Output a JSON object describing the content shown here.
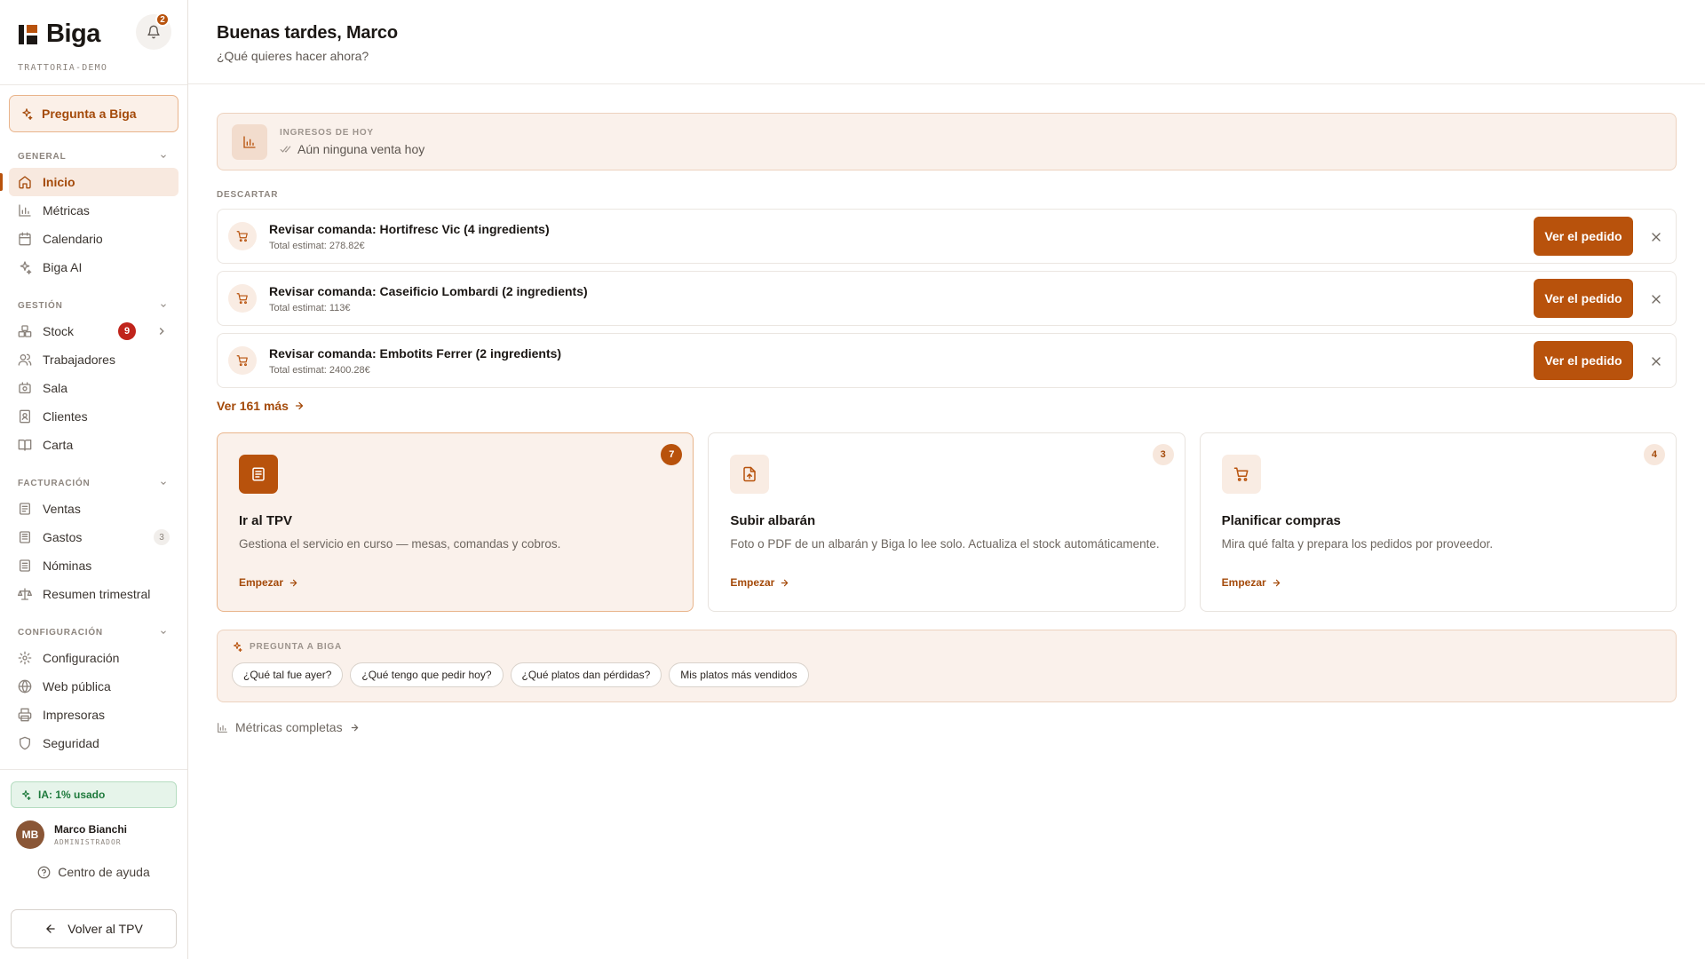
{
  "brand": {
    "name": "Biga",
    "org": "TRATTORIA-DEMO",
    "notifications": "2"
  },
  "sidebar": {
    "ask_label": "Pregunta a Biga",
    "groups": [
      {
        "title": "GENERAL",
        "items": [
          {
            "label": "Inicio",
            "icon": "home-icon",
            "active": true
          },
          {
            "label": "Métricas",
            "icon": "bar-chart-icon"
          },
          {
            "label": "Calendario",
            "icon": "calendar-icon"
          },
          {
            "label": "Biga AI",
            "icon": "sparkles-icon"
          }
        ]
      },
      {
        "title": "GESTIÓN",
        "items": [
          {
            "label": "Stock",
            "icon": "boxes-icon",
            "badge": "9"
          },
          {
            "label": "Trabajadores",
            "icon": "users-icon"
          },
          {
            "label": "Sala",
            "icon": "table-icon"
          },
          {
            "label": "Clientes",
            "icon": "contact-icon"
          },
          {
            "label": "Carta",
            "icon": "book-icon"
          }
        ]
      },
      {
        "title": "FACTURACIÓN",
        "items": [
          {
            "label": "Ventas",
            "icon": "receipt-icon"
          },
          {
            "label": "Gastos",
            "icon": "invoice-icon",
            "count": "3"
          },
          {
            "label": "Nóminas",
            "icon": "payroll-icon"
          },
          {
            "label": "Resumen trimestral",
            "icon": "scale-icon"
          }
        ]
      },
      {
        "title": "CONFIGURACIÓN",
        "items": [
          {
            "label": "Configuración",
            "icon": "gear-icon"
          },
          {
            "label": "Web pública",
            "icon": "globe-icon"
          },
          {
            "label": "Impresoras",
            "icon": "printer-icon"
          },
          {
            "label": "Seguridad",
            "icon": "shield-icon"
          }
        ]
      }
    ],
    "ai_usage": "IA: 1% usado",
    "user": {
      "initials": "MB",
      "name": "Marco Bianchi",
      "role": "ADMINISTRADOR"
    },
    "help": "Centro de ayuda",
    "back": "Volver al TPV"
  },
  "header": {
    "greeting": "Buenas tardes, Marco",
    "subtitle": "¿Qué quieres hacer ahora?"
  },
  "revenue": {
    "label": "INGRESOS DE HOY",
    "value": "Aún ninguna venta hoy"
  },
  "tasks": {
    "dismiss_label": "DESCARTAR",
    "items": [
      {
        "title": "Revisar comanda: Hortifresc Vic (4 ingredients)",
        "sub": "Total estimat: 278.82€",
        "button": "Ver el pedido"
      },
      {
        "title": "Revisar comanda: Caseificio Lombardi (2 ingredients)",
        "sub": "Total estimat: 113€",
        "button": "Ver el pedido"
      },
      {
        "title": "Revisar comanda: Embotits Ferrer (2 ingredients)",
        "sub": "Total estimat: 2400.28€",
        "button": "Ver el pedido"
      }
    ],
    "see_more": "Ver 161 más"
  },
  "cards": [
    {
      "title": "Ir al TPV",
      "desc": "Gestiona el servicio en curso — mesas, comandas y cobros.",
      "link": "Empezar",
      "count": "7",
      "icon": "document-icon"
    },
    {
      "title": "Subir albarán",
      "desc": "Foto o PDF de un albarán y Biga lo lee solo. Actualiza el stock automáticamente.",
      "link": "Empezar",
      "count": "3",
      "icon": "file-upload-icon"
    },
    {
      "title": "Planificar compras",
      "desc": "Mira qué falta y prepara los pedidos por proveedor.",
      "link": "Empezar",
      "count": "4",
      "icon": "cart-icon"
    }
  ],
  "ask": {
    "title": "PREGUNTA A BIGA",
    "chips": [
      "¿Qué tal fue ayer?",
      "¿Qué tengo que pedir hoy?",
      "¿Qué platos dan pérdidas?",
      "Mis platos más vendidos"
    ]
  },
  "metrics_link": "Métricas completas",
  "colors": {
    "accent": "#b8520c",
    "accent_soft": "#faf1eb",
    "danger": "#c0241b",
    "success": "#1e7a3c"
  }
}
